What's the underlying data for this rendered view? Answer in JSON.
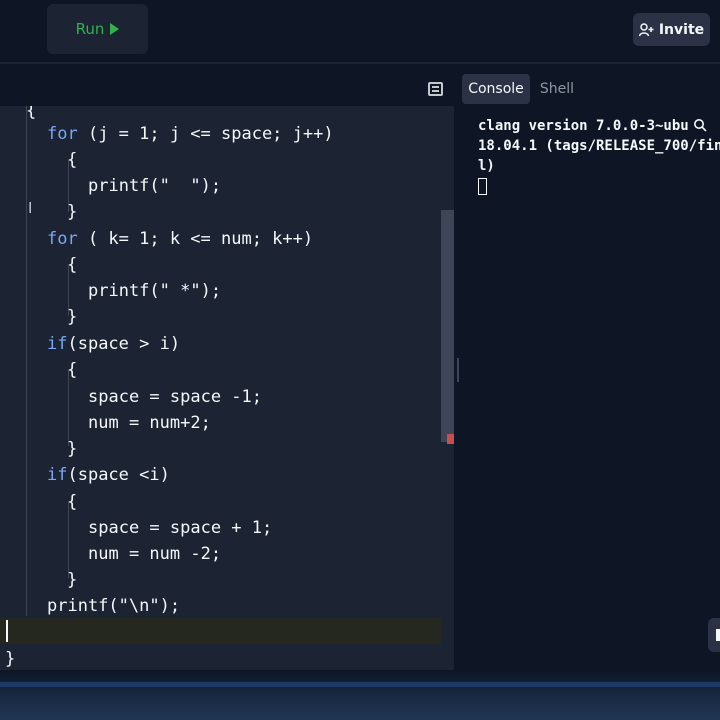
{
  "header": {
    "run_label": "Run",
    "invite_label": "Invite"
  },
  "console": {
    "tabs": [
      {
        "label": "Console"
      },
      {
        "label": "Shell"
      }
    ],
    "output": [
      "clang version 7.0.0-3~ubu",
      "18.04.1 (tags/RELEASE_700/fin",
      "l)"
    ]
  },
  "editor": {
    "top_partial": "{",
    "lines": [
      "for (j = 1; j <= space; j++)",
      "{",
      "printf(\"  \");",
      "}",
      "for ( k= 1; k <= num; k++)",
      "{",
      "printf(\" *\");",
      "}",
      "if(space > i)",
      "{",
      "space = space -1;",
      "num = num+2;",
      "}",
      "if(space <i)",
      "{",
      "space = space + 1;",
      "num = num -2;",
      "}",
      "printf(\"\\n\");",
      "",
      "}"
    ]
  },
  "colors": {
    "accent_run": "#2fb34a",
    "keyword": "#7aa7f5",
    "editor_bg": "#1c2333",
    "app_bg": "#0e1525"
  }
}
